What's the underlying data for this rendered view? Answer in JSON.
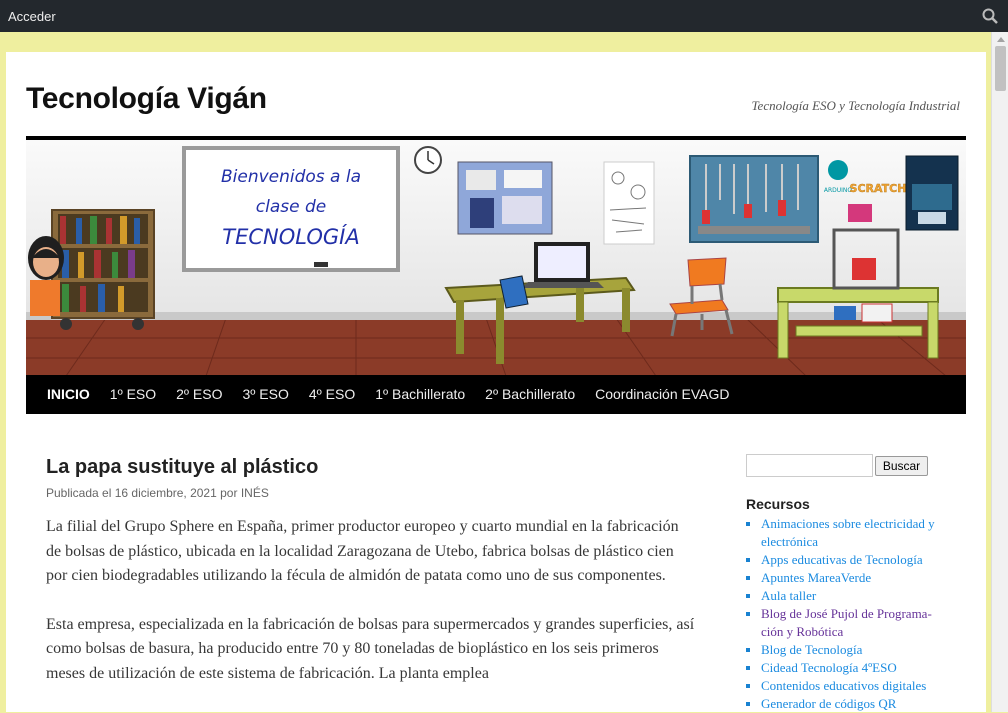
{
  "admin_bar": {
    "login_label": "Acceder"
  },
  "site": {
    "title": "Tecnología Vigán",
    "description": "Tecnología ESO y Tecnología Industrial"
  },
  "banner": {
    "whiteboard_line1": "Bienvenidos a la",
    "whiteboard_line2": "clase de",
    "whiteboard_line3": "TECNOLOGÍA",
    "scratch_label": "SCRATCH",
    "arduino_label": "ARDUINO"
  },
  "nav": {
    "items": [
      {
        "label": "INICIO"
      },
      {
        "label": "1º ESO"
      },
      {
        "label": "2º ESO"
      },
      {
        "label": "3º ESO"
      },
      {
        "label": "4º ESO"
      },
      {
        "label": "1º Bachillerato"
      },
      {
        "label": "2º Bachillerato"
      },
      {
        "label": "Coordinación EVAGD"
      }
    ]
  },
  "post": {
    "title": "La papa sustituye al plástico",
    "meta_prefix": "Publicada el ",
    "date": "16 diciembre, 2021",
    "meta_by": " por ",
    "author": "INÉS",
    "paragraphs": [
      " La filial del Grupo Sphere en España, primer productor europeo y cuarto mundial en la fabricación de bolsas de plástico, ubicada en la localidad Zaragozana de Utebo, fabrica bolsas de plástico cien por cien biodegradables utilizando la fécula de almidón de patata como uno de sus componentes.",
      "Esta empresa, especializada en la fabricación de bolsas para supermercados y grandes superficies, así como bolsas de basura, ha producido entre 70 y 80 toneladas de bioplástico en los seis primeros meses de utilización de este sistema de fabricación. La planta emplea"
    ]
  },
  "sidebar": {
    "search_placeholder": "",
    "search_button": "Buscar",
    "widget_title": "Recursos",
    "resources": [
      {
        "label": "Animaciones sobre electricidad y electrónica"
      },
      {
        "label": "Apps educativas de Tecnología"
      },
      {
        "label": "Apuntes MareaVerde"
      },
      {
        "label": "Aula taller"
      },
      {
        "label": "Blog de José Pujol de Programa-ción y Robótica"
      },
      {
        "label": "Blog de Tecnología"
      },
      {
        "label": "Cidead Tecnología 4ºESO"
      },
      {
        "label": "Contenidos educativos digitales"
      },
      {
        "label": "Generador de códigos QR"
      }
    ]
  }
}
